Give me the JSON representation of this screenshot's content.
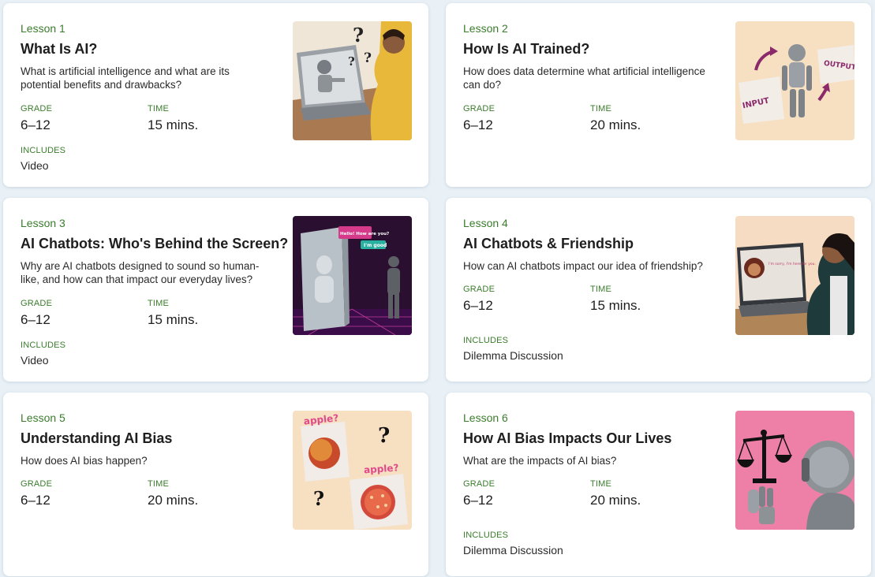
{
  "labels": {
    "grade": "GRADE",
    "time": "TIME",
    "includes": "INCLUDES"
  },
  "lessons": [
    {
      "number": "Lesson 1",
      "title": "What Is AI?",
      "description": "What is artificial intelligence and what are its potential benefits and drawbacks?",
      "grade": "6–12",
      "time": "15 mins.",
      "includes": "Video"
    },
    {
      "number": "Lesson 2",
      "title": "How Is AI Trained?",
      "description": "How does data determine what artificial intelligence can do?",
      "grade": "6–12",
      "time": "20 mins.",
      "thumb_text": {
        "input": "INPUT",
        "output": "OUTPUT"
      }
    },
    {
      "number": "Lesson 3",
      "title": "AI Chatbots: Who's Behind the Screen?",
      "description": "Why are AI chatbots designed to sound so human-like, and how can that impact our everyday lives?",
      "grade": "6–12",
      "time": "15 mins.",
      "includes": "Video",
      "thumb_text": {
        "bubble1": "Hello! How are you?",
        "bubble2": "I'm good"
      }
    },
    {
      "number": "Lesson 4",
      "title": "AI Chatbots & Friendship",
      "description": "How can AI chatbots impact our idea of friendship?",
      "grade": "6–12",
      "time": "15 mins.",
      "includes": "Dilemma Discussion",
      "thumb_text": {
        "screen": "I'm sorry, I'm here for you."
      }
    },
    {
      "number": "Lesson 5",
      "title": "Understanding AI Bias",
      "description": "How does AI bias happen?",
      "grade": "6–12",
      "time": "20 mins.",
      "thumb_text": {
        "apple1": "apple?",
        "apple2": "apple?"
      }
    },
    {
      "number": "Lesson 6",
      "title": "How AI Bias Impacts Our Lives",
      "description": "What are the impacts of AI bias?",
      "grade": "6–12",
      "time": "20 mins.",
      "includes": "Dilemma Discussion"
    }
  ],
  "colors": {
    "accent_green": "#3a7d2c",
    "page_bg": "#e9f1f7",
    "card_bg": "#ffffff"
  },
  "icons": [
    "robot-laptop-thumb",
    "robot-input-output-thumb",
    "chatbot-screen-thumb",
    "chatbot-friend-thumb",
    "apple-bias-thumb",
    "scales-robot-thumb"
  ]
}
